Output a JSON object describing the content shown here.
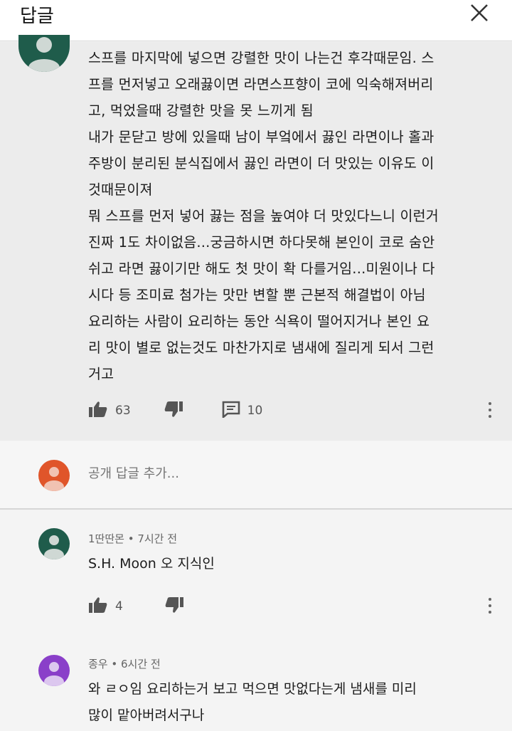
{
  "header": {
    "title": "답글",
    "close_icon": "close-icon"
  },
  "main_comment": {
    "lines": [
      "스프를 마지막에 넣으면 강렬한 맛이 나는건 후각때문임. 스",
      "프를 먼저넣고 오래끓이면 라면스프향이 코에 익숙해져버리",
      "고, 먹었을때 강렬한 맛을 못 느끼게 됨",
      "내가 문닫고 방에 있을때 남이 부엌에서 끓인 라면이나 홀과",
      "주방이 분리된 분식집에서 끓인 라면이 더 맛있는 이유도 이",
      "것때문이져",
      "뭐 스프를 먼저 넣어 끓는 점을 높여야 더 맛있다느니 이런거",
      "진짜 1도 차이없음...궁금하시면 하다못해 본인이 코로 숨안",
      "쉬고 라면 끓이기만 해도 첫 맛이 확 다를거임...미원이나 다",
      "시다 등 조미료 첨가는 맛만 변할 뿐 근본적 해결법이 아님",
      "요리하는 사람이 요리하는 동안 식욕이 떨어지거나 본인 요",
      "리 맛이 별로 없는것도 마찬가지로 냄새에 질리게 되서 그런",
      "거고"
    ],
    "likes": "63",
    "replies": "10"
  },
  "reply_box": {
    "placeholder": "공개 답글 추가..."
  },
  "replies": [
    {
      "author": "1딴딴몬",
      "time": "7시간 전",
      "meta": "1딴딴몬 • 7시간 전",
      "text_lines": [
        "S.H. Moon 오 지식인"
      ],
      "likes": "4"
    },
    {
      "author": "종우",
      "time": "6시간 전",
      "meta": "종우 • 6시간 전",
      "text_lines": [
        "와 ㄹㅇ임 요리하는거 보고 먹으면 맛없다는게  냄새를 미리",
        "많이 맡아버려서구나"
      ]
    }
  ],
  "colors": {
    "avatar_green": "#1f5c4b",
    "avatar_orange": "#e0552a",
    "avatar_purple": "#8a3fc9",
    "icon_gray": "#555555"
  }
}
